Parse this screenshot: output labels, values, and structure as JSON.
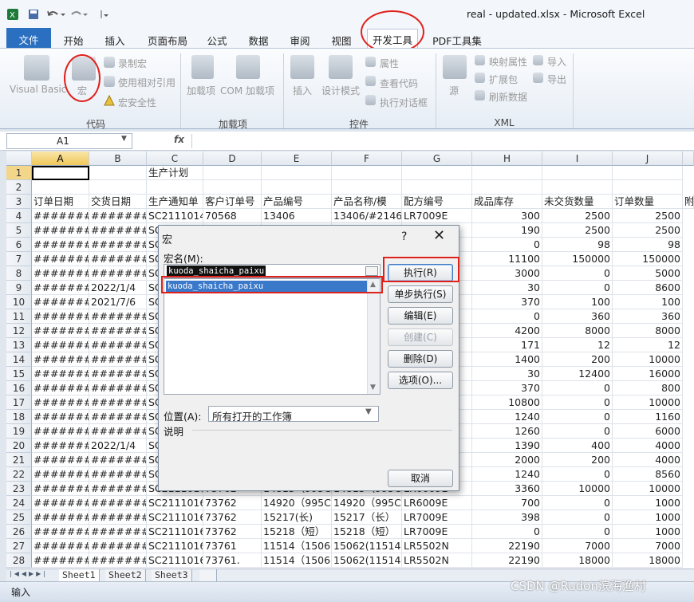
{
  "window": {
    "title": "real - updated.xlsx - Microsoft Excel"
  },
  "ribbon_tabs": [
    {
      "label": "文件"
    },
    {
      "label": "开始"
    },
    {
      "label": "插入"
    },
    {
      "label": "页面布局"
    },
    {
      "label": "公式"
    },
    {
      "label": "数据"
    },
    {
      "label": "审阅"
    },
    {
      "label": "视图"
    },
    {
      "label": "开发工具"
    },
    {
      "label": "PDF工具集"
    }
  ],
  "ribbon": {
    "code": {
      "visual_basic": "Visual Basic",
      "macro": "宏",
      "record_macro": "录制宏",
      "relative_ref": "使用相对引用",
      "macro_security": "宏安全性",
      "group": "代码"
    },
    "addins": {
      "addins": "加载项",
      "com_addins": "COM 加载项",
      "group": "加载项"
    },
    "controls": {
      "insert": "插入",
      "design_mode": "设计模式",
      "properties": "属性",
      "view_code": "查看代码",
      "run_dialog": "执行对话框",
      "group": "控件"
    },
    "xml": {
      "source": "源",
      "map_props": "映射属性",
      "expansion_pack": "扩展包",
      "refresh_data": "刷新数据",
      "import": "导入",
      "export": "导出",
      "group": "XML"
    }
  },
  "formula_bar": {
    "name_box": "A1",
    "fx": "fx"
  },
  "columns": [
    "A",
    "B",
    "C",
    "D",
    "E",
    "F",
    "G",
    "H",
    "I",
    "J"
  ],
  "rows": [
    [
      "1",
      "",
      "",
      "生产计划",
      "",
      "",
      "",
      "",
      "",
      "",
      ""
    ],
    [
      "2",
      "",
      "",
      "",
      "",
      "",
      "",
      "",
      "",
      "",
      ""
    ],
    [
      "3",
      "订单日期",
      "交货日期",
      "生产通知单",
      "客户订单号",
      "产品编号",
      "产品名称/模",
      "配方编号",
      "成品库存",
      "未交货数量",
      "订单数量",
      "附"
    ],
    [
      "4",
      "########",
      "########",
      "SC2111014",
      "70568",
      "13406",
      "13406/#2146",
      "LR7009E",
      "300",
      "2500",
      "2500"
    ],
    [
      "5",
      "########",
      "########",
      "SC",
      "",
      "",
      "",
      "R",
      "190",
      "2500",
      "2500"
    ],
    [
      "6",
      "########",
      "########",
      "SC",
      "",
      "",
      "",
      "",
      "0",
      "98",
      "98"
    ],
    [
      "7",
      "########",
      "########",
      "SC",
      "",
      "",
      "",
      "",
      "11100",
      "150000",
      "150000"
    ],
    [
      "8",
      "########",
      "########",
      "SC",
      "",
      "",
      "",
      "",
      "3000",
      "0",
      "5000"
    ],
    [
      "9",
      "########",
      "2022/1/4",
      "SC",
      "",
      "",
      "",
      "",
      "30",
      "0",
      "8600"
    ],
    [
      "10",
      "########",
      "2021/7/6",
      "SC",
      "",
      "",
      "",
      "-BL",
      "370",
      "100",
      "100"
    ],
    [
      "11",
      "########",
      "########",
      "SC",
      "",
      "",
      "",
      "",
      "0",
      "360",
      "360"
    ],
    [
      "12",
      "########",
      "########",
      "SC",
      "",
      "",
      "",
      "",
      "4200",
      "8000",
      "8000"
    ],
    [
      "13",
      "########",
      "########",
      "SC",
      "",
      "",
      "",
      "",
      "171",
      "12",
      "12"
    ],
    [
      "14",
      "########",
      "########",
      "SC",
      "",
      "",
      "",
      "",
      "1400",
      "200",
      "10000"
    ],
    [
      "15",
      "########",
      "########",
      "SC",
      "",
      "",
      "",
      "",
      "30",
      "12400",
      "16000"
    ],
    [
      "16",
      "########",
      "########",
      "SC",
      "",
      "",
      "",
      "-BL",
      "370",
      "0",
      "800"
    ],
    [
      "17",
      "########",
      "########",
      "SC",
      "",
      "",
      "",
      "",
      "10800",
      "0",
      "10000"
    ],
    [
      "18",
      "########",
      "########",
      "SC",
      "",
      "",
      "",
      "",
      "1240",
      "0",
      "1160"
    ],
    [
      "19",
      "########",
      "########",
      "SC",
      "",
      "",
      "",
      "-BL",
      "1260",
      "0",
      "6000"
    ],
    [
      "20",
      "########",
      "2022/1/4",
      "SC",
      "",
      "",
      "",
      "-BL",
      "1390",
      "400",
      "4000"
    ],
    [
      "21",
      "########",
      "########",
      "SC",
      "",
      "",
      "",
      "-BL",
      "2000",
      "200",
      "4000"
    ],
    [
      "22",
      "########",
      "########",
      "SC",
      "",
      "",
      "",
      "",
      "1240",
      "0",
      "8560"
    ],
    [
      "23",
      "########",
      "########",
      "SC2111016",
      "73762",
      "14815（995C",
      "14815（995C",
      "LR6009E",
      "3360",
      "10000",
      "10000"
    ],
    [
      "24",
      "########",
      "########",
      "SC2111016",
      "73762",
      "14920（995C",
      "14920（995C",
      "LR6009E",
      "700",
      "0",
      "1000"
    ],
    [
      "25",
      "########",
      "########",
      "SC2111016",
      "73762",
      "15217(长)",
      "15217（长）",
      "LR7009E",
      "398",
      "0",
      "1000"
    ],
    [
      "26",
      "########",
      "########",
      "SC2111016",
      "73762",
      "15218（短）",
      "15218（短）",
      "LR7009E",
      "0",
      "0",
      "1000"
    ],
    [
      "27",
      "########",
      "########",
      "SC2111016",
      "73761",
      "11514（1506",
      "15062(11514",
      "LR5502N",
      "22190",
      "7000",
      "7000"
    ],
    [
      "28",
      "########",
      "########",
      "SC2111016",
      "73761.",
      "11514（1506",
      "15062(11514",
      "LR5502N",
      "22190",
      "18000",
      "18000"
    ]
  ],
  "dialog": {
    "title": "宏",
    "help": "?",
    "close": "✕",
    "macro_name_label": "宏名(M):",
    "macro_name_value": "kuoda_shaicha_paixu",
    "macro_list": [
      "kuoda_shaicha_paixu"
    ],
    "buttons": {
      "run": "执行(R)",
      "step": "单步执行(S)",
      "edit": "编辑(E)",
      "create": "创建(C)",
      "delete": "删除(D)",
      "options": "选项(O)..."
    },
    "location_label": "位置(A):",
    "location_value": "所有打开的工作簿",
    "description_label": "说明",
    "cancel": "取消"
  },
  "sheets": [
    "Sheet1",
    "Sheet2",
    "Sheet3"
  ],
  "status": {
    "mode": "输入"
  },
  "watermark": "CSDN @Rudon滨海渔村",
  "accent": {
    "file_tab": "#2a6fc0",
    "highlight": "#e0211b",
    "selection": "#3a78c9"
  }
}
